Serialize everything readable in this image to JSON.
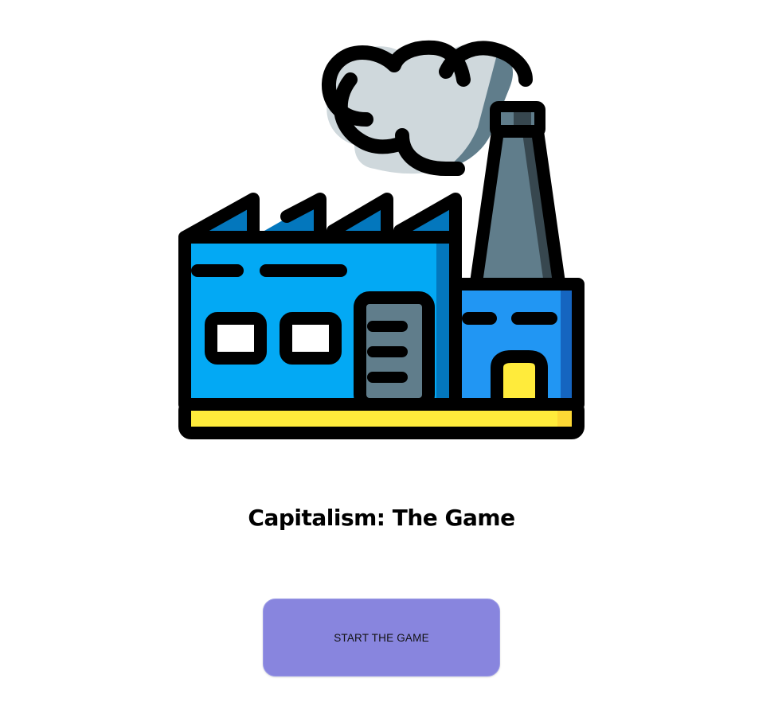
{
  "page": {
    "title": "Capitalism: The Game",
    "start_button_label": "START THE GAME"
  },
  "hero": {
    "icon": "factory-icon"
  },
  "colors": {
    "button_bg": "#8885de",
    "building_blue": "#03a9f4",
    "building_dark_blue": "#0377bd",
    "annex_blue": "#2196f3",
    "chimney_gray": "#607d8b",
    "smoke_gray": "#cfd8dc",
    "base_yellow": "#ffeb3b",
    "outline": "#000000"
  }
}
